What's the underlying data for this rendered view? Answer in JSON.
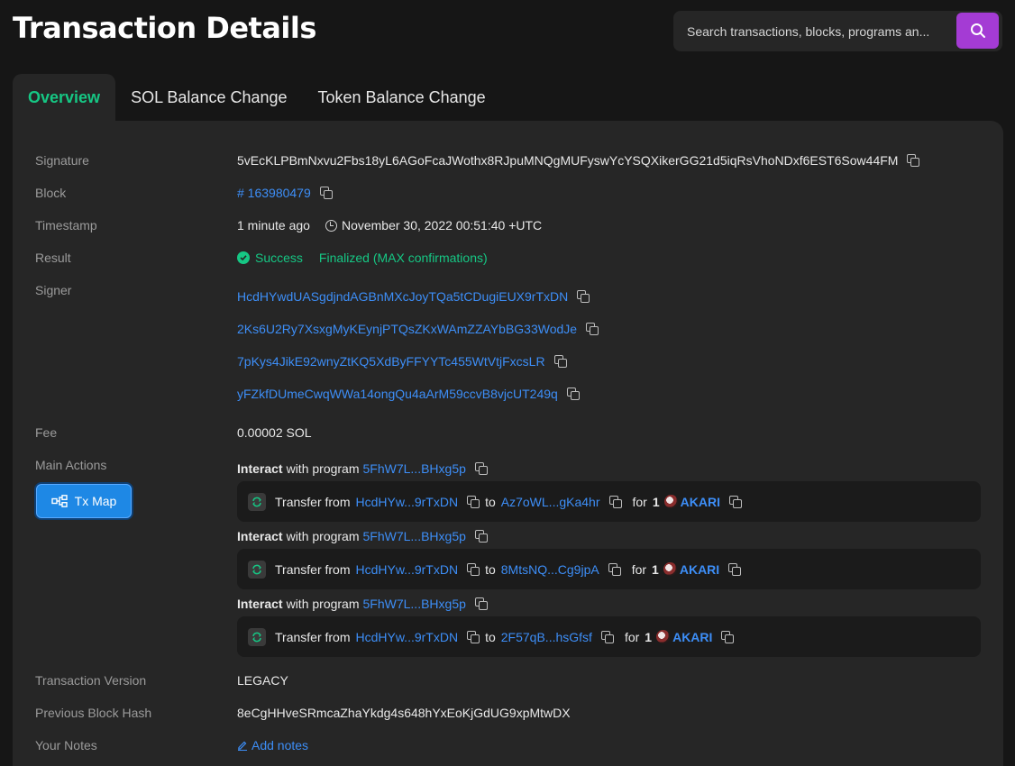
{
  "page_title": "Transaction Details",
  "search": {
    "placeholder": "Search transactions, blocks, programs an..."
  },
  "tabs": [
    {
      "label": "Overview"
    },
    {
      "label": "SOL Balance Change"
    },
    {
      "label": "Token Balance Change"
    }
  ],
  "labels": {
    "signature": "Signature",
    "block": "Block",
    "timestamp": "Timestamp",
    "result": "Result",
    "signer": "Signer",
    "fee": "Fee",
    "main_actions": "Main Actions",
    "tx_version": "Transaction Version",
    "prev_block_hash": "Previous Block Hash",
    "your_notes": "Your Notes"
  },
  "values": {
    "signature": "5vEcKLPBmNxvu2Fbs18yL6AGoFcaJWothx8RJpuMNQgMUFyswYcYSQXikerGG21d5iqRsVhoNDxf6EST6Sow44FM",
    "block": "# 163980479",
    "timestamp_relative": "1 minute ago",
    "timestamp_absolute": "November 30, 2022 00:51:40 +UTC",
    "result_status": "Success",
    "result_finality": "Finalized (MAX confirmations)",
    "signers": [
      "HcdHYwdUASgdjndAGBnMXcJoyTQa5tCDugiEUX9rTxDN",
      "2Ks6U2Ry7XsxgMyKEynjPTQsZKxWAmZZAYbBG33WodJe",
      "7pKys4JikE92wnyZtKQ5XdByFFYYTc455WtVtjFxcsLR",
      "yFZkfDUmeCwqWWa14ongQu4aArM59ccvB8vjcUT249q"
    ],
    "fee": "0.00002 SOL",
    "tx_version": "LEGACY",
    "prev_block_hash": "8eCgHHveSRmcaZhaYkdg4s648hYxEoKjGdUG9xpMtwDX",
    "add_notes": "Add notes"
  },
  "tx_map_button": "Tx Map",
  "actions": [
    {
      "interact": "Interact",
      "with_program": "with program",
      "program": "5FhW7L...BHxg5p",
      "transfer": "Transfer from",
      "from": "HcdHYw...9rTxDN",
      "to_label": "to",
      "to": "Az7oWL...gKa4hr",
      "for_label": "for",
      "amount": "1",
      "token": "AKARI"
    },
    {
      "interact": "Interact",
      "with_program": "with program",
      "program": "5FhW7L...BHxg5p",
      "transfer": "Transfer from",
      "from": "HcdHYw...9rTxDN",
      "to_label": "to",
      "to": "8MtsNQ...Cg9jpA",
      "for_label": "for",
      "amount": "1",
      "token": "AKARI"
    },
    {
      "interact": "Interact",
      "with_program": "with program",
      "program": "5FhW7L...BHxg5p",
      "transfer": "Transfer from",
      "from": "HcdHYw...9rTxDN",
      "to_label": "to",
      "to": "2F57qB...hsGfsf",
      "for_label": "for",
      "amount": "1",
      "token": "AKARI"
    }
  ]
}
